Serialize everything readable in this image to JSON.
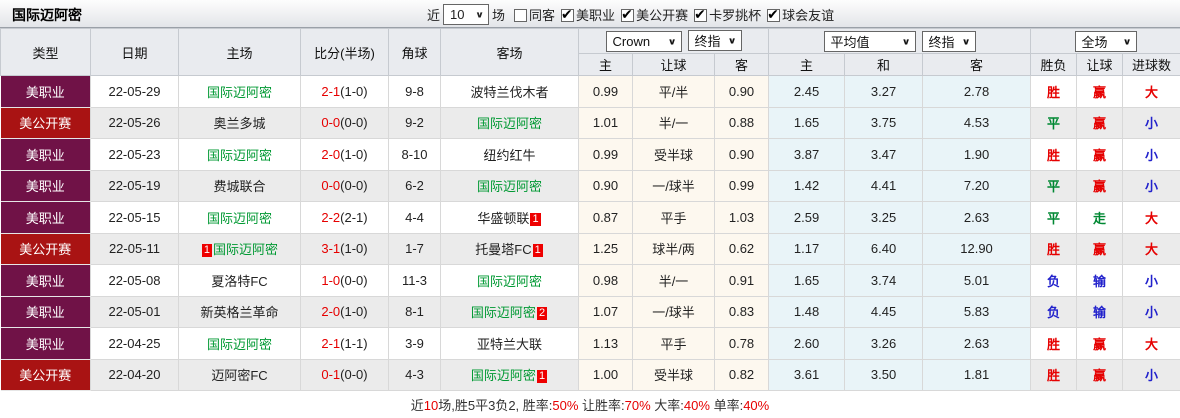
{
  "panel": {
    "title": "国际迈阿密"
  },
  "filter": {
    "near_label": "近",
    "count": "10",
    "unit_label": "场",
    "checkboxes": [
      {
        "label": "同客",
        "checked": false
      },
      {
        "label": "美职业",
        "checked": true
      },
      {
        "label": "美公开赛",
        "checked": true
      },
      {
        "label": "卡罗挑杯",
        "checked": true
      },
      {
        "label": "球会友谊",
        "checked": true
      }
    ]
  },
  "table": {
    "headers": [
      "类型",
      "日期",
      "主场",
      "比分(半场)",
      "角球",
      "客场"
    ],
    "selects": {
      "book": "Crown",
      "book_ref": "终指",
      "avg": "平均值",
      "avg_ref": "终指",
      "scope": "全场"
    },
    "sub_headers": [
      "主",
      "让球",
      "客",
      "主",
      "和",
      "客",
      "胜负",
      "让球",
      "进球数"
    ],
    "rows": [
      {
        "league": "美职业",
        "league_class": "mls",
        "date": "22-05-29",
        "home": {
          "name": "国际迈阿密",
          "focus": true
        },
        "score_ft": "2-1",
        "score_ht": "(1-0)",
        "corner": "9-8",
        "away": {
          "name": "波特兰伐木者",
          "focus": false
        },
        "crown": [
          "0.99",
          "平/半",
          "0.90"
        ],
        "avg": [
          "2.45",
          "3.27",
          "2.78"
        ],
        "results": [
          {
            "t": "胜",
            "c": "red"
          },
          {
            "t": "赢",
            "c": "red"
          },
          {
            "t": "大",
            "c": "red"
          }
        ]
      },
      {
        "league": "美公开赛",
        "league_class": "open",
        "date": "22-05-26",
        "home": {
          "name": "奥兰多城",
          "focus": false
        },
        "score_ft": "0-0",
        "score_ht": "(0-0)",
        "corner": "9-2",
        "away": {
          "name": "国际迈阿密",
          "focus": true
        },
        "crown": [
          "1.01",
          "半/一",
          "0.88"
        ],
        "avg": [
          "1.65",
          "3.75",
          "4.53"
        ],
        "results": [
          {
            "t": "平",
            "c": "green"
          },
          {
            "t": "赢",
            "c": "red"
          },
          {
            "t": "小",
            "c": "blue"
          }
        ]
      },
      {
        "league": "美职业",
        "league_class": "mls",
        "date": "22-05-23",
        "home": {
          "name": "国际迈阿密",
          "focus": true
        },
        "score_ft": "2-0",
        "score_ht": "(1-0)",
        "corner": "8-10",
        "away": {
          "name": "纽约红牛",
          "focus": false
        },
        "crown": [
          "0.99",
          "受半球",
          "0.90"
        ],
        "avg": [
          "3.87",
          "3.47",
          "1.90"
        ],
        "results": [
          {
            "t": "胜",
            "c": "red"
          },
          {
            "t": "赢",
            "c": "red"
          },
          {
            "t": "小",
            "c": "blue"
          }
        ]
      },
      {
        "league": "美职业",
        "league_class": "mls",
        "date": "22-05-19",
        "home": {
          "name": "费城联合",
          "focus": false
        },
        "score_ft": "0-0",
        "score_ht": "(0-0)",
        "corner": "6-2",
        "away": {
          "name": "国际迈阿密",
          "focus": true
        },
        "crown": [
          "0.90",
          "一/球半",
          "0.99"
        ],
        "avg": [
          "1.42",
          "4.41",
          "7.20"
        ],
        "results": [
          {
            "t": "平",
            "c": "green"
          },
          {
            "t": "赢",
            "c": "red"
          },
          {
            "t": "小",
            "c": "blue"
          }
        ]
      },
      {
        "league": "美职业",
        "league_class": "mls",
        "date": "22-05-15",
        "home": {
          "name": "国际迈阿密",
          "focus": true
        },
        "score_ft": "2-2",
        "score_ht": "(2-1)",
        "corner": "4-4",
        "away": {
          "name": "华盛顿联",
          "focus": false,
          "badge": "1"
        },
        "crown": [
          "0.87",
          "平手",
          "1.03"
        ],
        "avg": [
          "2.59",
          "3.25",
          "2.63"
        ],
        "results": [
          {
            "t": "平",
            "c": "green"
          },
          {
            "t": "走",
            "c": "green"
          },
          {
            "t": "大",
            "c": "red"
          }
        ]
      },
      {
        "league": "美公开赛",
        "league_class": "open",
        "date": "22-05-11",
        "home": {
          "name": "国际迈阿密",
          "focus": true,
          "badge": "1",
          "badge_pos": "before"
        },
        "score_ft": "3-1",
        "score_ht": "(1-0)",
        "corner": "1-7",
        "away": {
          "name": "托曼塔FC",
          "focus": false,
          "badge": "1"
        },
        "crown": [
          "1.25",
          "球半/两",
          "0.62"
        ],
        "avg": [
          "1.17",
          "6.40",
          "12.90"
        ],
        "results": [
          {
            "t": "胜",
            "c": "red"
          },
          {
            "t": "赢",
            "c": "red"
          },
          {
            "t": "大",
            "c": "red"
          }
        ]
      },
      {
        "league": "美职业",
        "league_class": "mls",
        "date": "22-05-08",
        "home": {
          "name": "夏洛特FC",
          "focus": false
        },
        "score_ft": "1-0",
        "score_ht": "(0-0)",
        "corner": "11-3",
        "away": {
          "name": "国际迈阿密",
          "focus": true
        },
        "crown": [
          "0.98",
          "半/一",
          "0.91"
        ],
        "avg": [
          "1.65",
          "3.74",
          "5.01"
        ],
        "results": [
          {
            "t": "负",
            "c": "blue"
          },
          {
            "t": "输",
            "c": "blue"
          },
          {
            "t": "小",
            "c": "blue"
          }
        ]
      },
      {
        "league": "美职业",
        "league_class": "mls",
        "date": "22-05-01",
        "home": {
          "name": "新英格兰革命",
          "focus": false
        },
        "score_ft": "2-0",
        "score_ht": "(1-0)",
        "corner": "8-1",
        "away": {
          "name": "国际迈阿密",
          "focus": true,
          "badge": "2"
        },
        "crown": [
          "1.07",
          "一/球半",
          "0.83"
        ],
        "avg": [
          "1.48",
          "4.45",
          "5.83"
        ],
        "results": [
          {
            "t": "负",
            "c": "blue"
          },
          {
            "t": "输",
            "c": "blue"
          },
          {
            "t": "小",
            "c": "blue"
          }
        ]
      },
      {
        "league": "美职业",
        "league_class": "mls",
        "date": "22-04-25",
        "home": {
          "name": "国际迈阿密",
          "focus": true
        },
        "score_ft": "2-1",
        "score_ht": "(1-1)",
        "corner": "3-9",
        "away": {
          "name": "亚特兰大联",
          "focus": false
        },
        "crown": [
          "1.13",
          "平手",
          "0.78"
        ],
        "avg": [
          "2.60",
          "3.26",
          "2.63"
        ],
        "results": [
          {
            "t": "胜",
            "c": "red"
          },
          {
            "t": "赢",
            "c": "red"
          },
          {
            "t": "大",
            "c": "red"
          }
        ]
      },
      {
        "league": "美公开赛",
        "league_class": "open",
        "date": "22-04-20",
        "home": {
          "name": "迈阿密FC",
          "focus": false
        },
        "score_ft": "0-1",
        "score_ht": "(0-0)",
        "corner": "4-3",
        "away": {
          "name": "国际迈阿密",
          "focus": true,
          "badge": "1"
        },
        "crown": [
          "1.00",
          "受半球",
          "0.82"
        ],
        "avg": [
          "3.61",
          "3.50",
          "1.81"
        ],
        "results": [
          {
            "t": "胜",
            "c": "red"
          },
          {
            "t": "赢",
            "c": "red"
          },
          {
            "t": "小",
            "c": "blue"
          }
        ]
      }
    ]
  },
  "footer": {
    "segments": [
      {
        "t": "近",
        "red": false
      },
      {
        "t": "10",
        "red": true
      },
      {
        "t": "场,胜5平3负2, 胜率:",
        "red": false
      },
      {
        "t": "50%",
        "red": true
      },
      {
        "t": " 让胜率:",
        "red": false
      },
      {
        "t": "70%",
        "red": true
      },
      {
        "t": " 大率:",
        "red": false
      },
      {
        "t": "40%",
        "red": true
      },
      {
        "t": " 单率:",
        "red": false
      },
      {
        "t": "40%",
        "red": true
      }
    ]
  },
  "colors": {
    "focus_team_green": "#009933",
    "win_red": "#e60000",
    "draw_green": "#008833",
    "lose_blue": "#2222cc",
    "league_mls_bg": "#701247",
    "league_open_bg": "#a91313",
    "crown_col_bg": "#fdf8ef",
    "avg_col_bg": "#e9f4f8",
    "stripe_gray": "#ebebeb",
    "badge_red": "#ee0000"
  }
}
